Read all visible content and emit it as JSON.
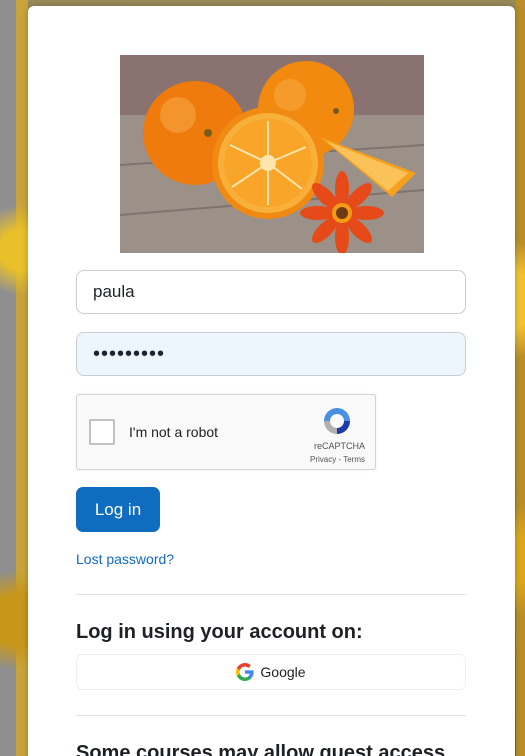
{
  "login": {
    "username_value": "paula",
    "password_value": "•••••••••",
    "captcha": {
      "label": "I'm not a robot",
      "brand": "reCAPTCHA",
      "links": "Privacy - Terms"
    },
    "login_button": "Log in",
    "lost_password_link": "Lost password?"
  },
  "identity_providers": {
    "heading": "Log in using your account on:",
    "providers": [
      {
        "label": "Google",
        "icon": "google-icon"
      }
    ]
  },
  "partial_text": "Some courses may allow guest access"
}
